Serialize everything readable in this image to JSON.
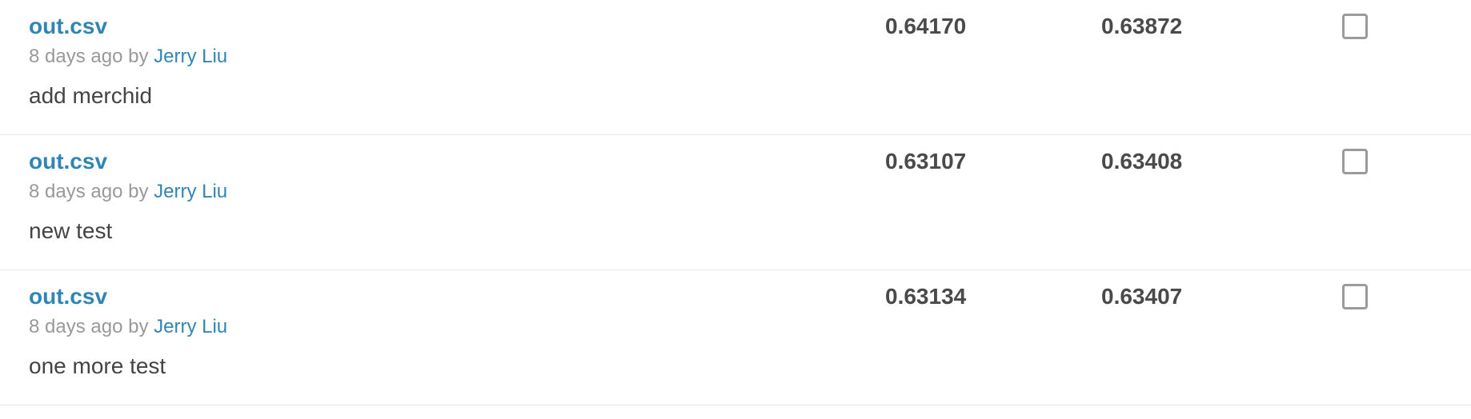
{
  "submissions": [
    {
      "file_name": "out.csv",
      "time_ago": "8 days ago",
      "by_label": "by",
      "author": "Jerry Liu",
      "description": "add merchid",
      "private_score": "0.64170",
      "public_score": "0.63872",
      "selected": false
    },
    {
      "file_name": "out.csv",
      "time_ago": "8 days ago",
      "by_label": "by",
      "author": "Jerry Liu",
      "description": "new test",
      "private_score": "0.63107",
      "public_score": "0.63408",
      "selected": false
    },
    {
      "file_name": "out.csv",
      "time_ago": "8 days ago",
      "by_label": "by",
      "author": "Jerry Liu",
      "description": "one more test",
      "private_score": "0.63134",
      "public_score": "0.63407",
      "selected": false
    }
  ],
  "colors": {
    "link": "#2f86b5",
    "meta": "#999999",
    "text": "#444444",
    "divider": "#e6e6e6"
  }
}
